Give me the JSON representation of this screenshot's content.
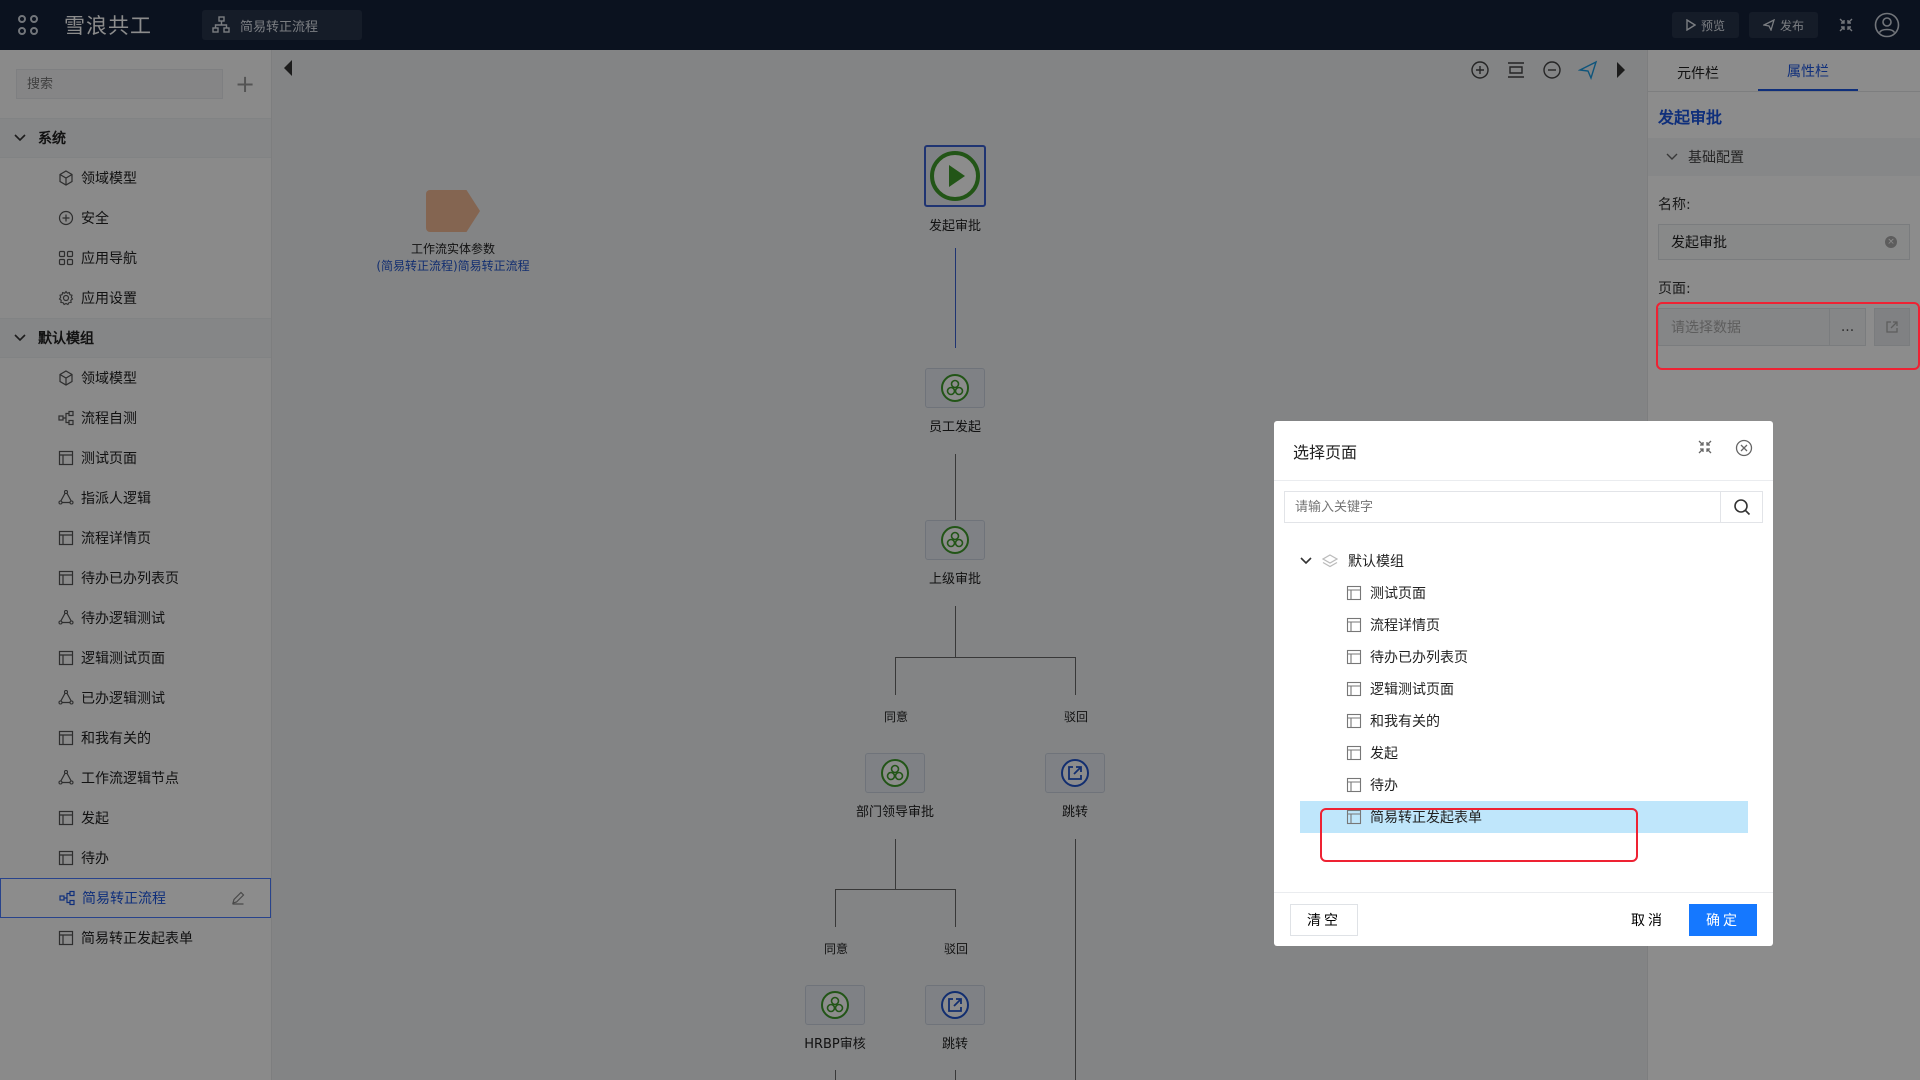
{
  "app": {
    "title": "雪浪共工",
    "flow_tab": "简易转正流程"
  },
  "top_actions": {
    "preview": "预览",
    "publish": "发布"
  },
  "sidebar": {
    "search_placeholder": "搜索",
    "add": "+",
    "groups": [
      {
        "label": "系统",
        "items": [
          "领域模型",
          "安全",
          "应用导航",
          "应用设置"
        ]
      },
      {
        "label": "默认模组",
        "items": [
          "领域模型",
          "流程自测",
          "测试页面",
          "指派人逻辑",
          "流程详情页",
          "待办已办列表页",
          "待办逻辑测试",
          "逻辑测试页面",
          "已办逻辑测试",
          "和我有关的",
          "工作流逻辑节点",
          "发起",
          "待办",
          "简易转正流程",
          "简易转正发起表单"
        ]
      }
    ]
  },
  "canvas": {
    "entity_title": "工作流实体参数",
    "entity_sub": "(简易转正流程)简易转正流程",
    "nodes": [
      "发起审批",
      "员工发起",
      "上级审批",
      "部门领导审批",
      "跳转",
      "HRBP审核",
      "跳转"
    ],
    "edge_labels": [
      "同意",
      "驳回",
      "同意",
      "驳回"
    ]
  },
  "right_panel": {
    "tabs": [
      "元件栏",
      "属性栏"
    ],
    "title": "发起审批",
    "section": "基础配置",
    "name_label": "名称:",
    "name_value": "发起审批",
    "page_label": "页面:",
    "page_placeholder": "请选择数据",
    "dots": "..."
  },
  "modal": {
    "title": "选择页面",
    "search_placeholder": "请输入关键字",
    "root": "默认模组",
    "items": [
      "测试页面",
      "流程详情页",
      "待办已办列表页",
      "逻辑测试页面",
      "和我有关的",
      "发起",
      "待办",
      "简易转正发起表单"
    ],
    "clear": "清空",
    "cancel": "取消",
    "confirm": "确定"
  },
  "colors": {
    "accent": "#1d56e0",
    "primary_button": "#1578ff",
    "highlight": "#ee2233",
    "selected_row": "#bfe6fb",
    "topbar": "#15223a"
  }
}
